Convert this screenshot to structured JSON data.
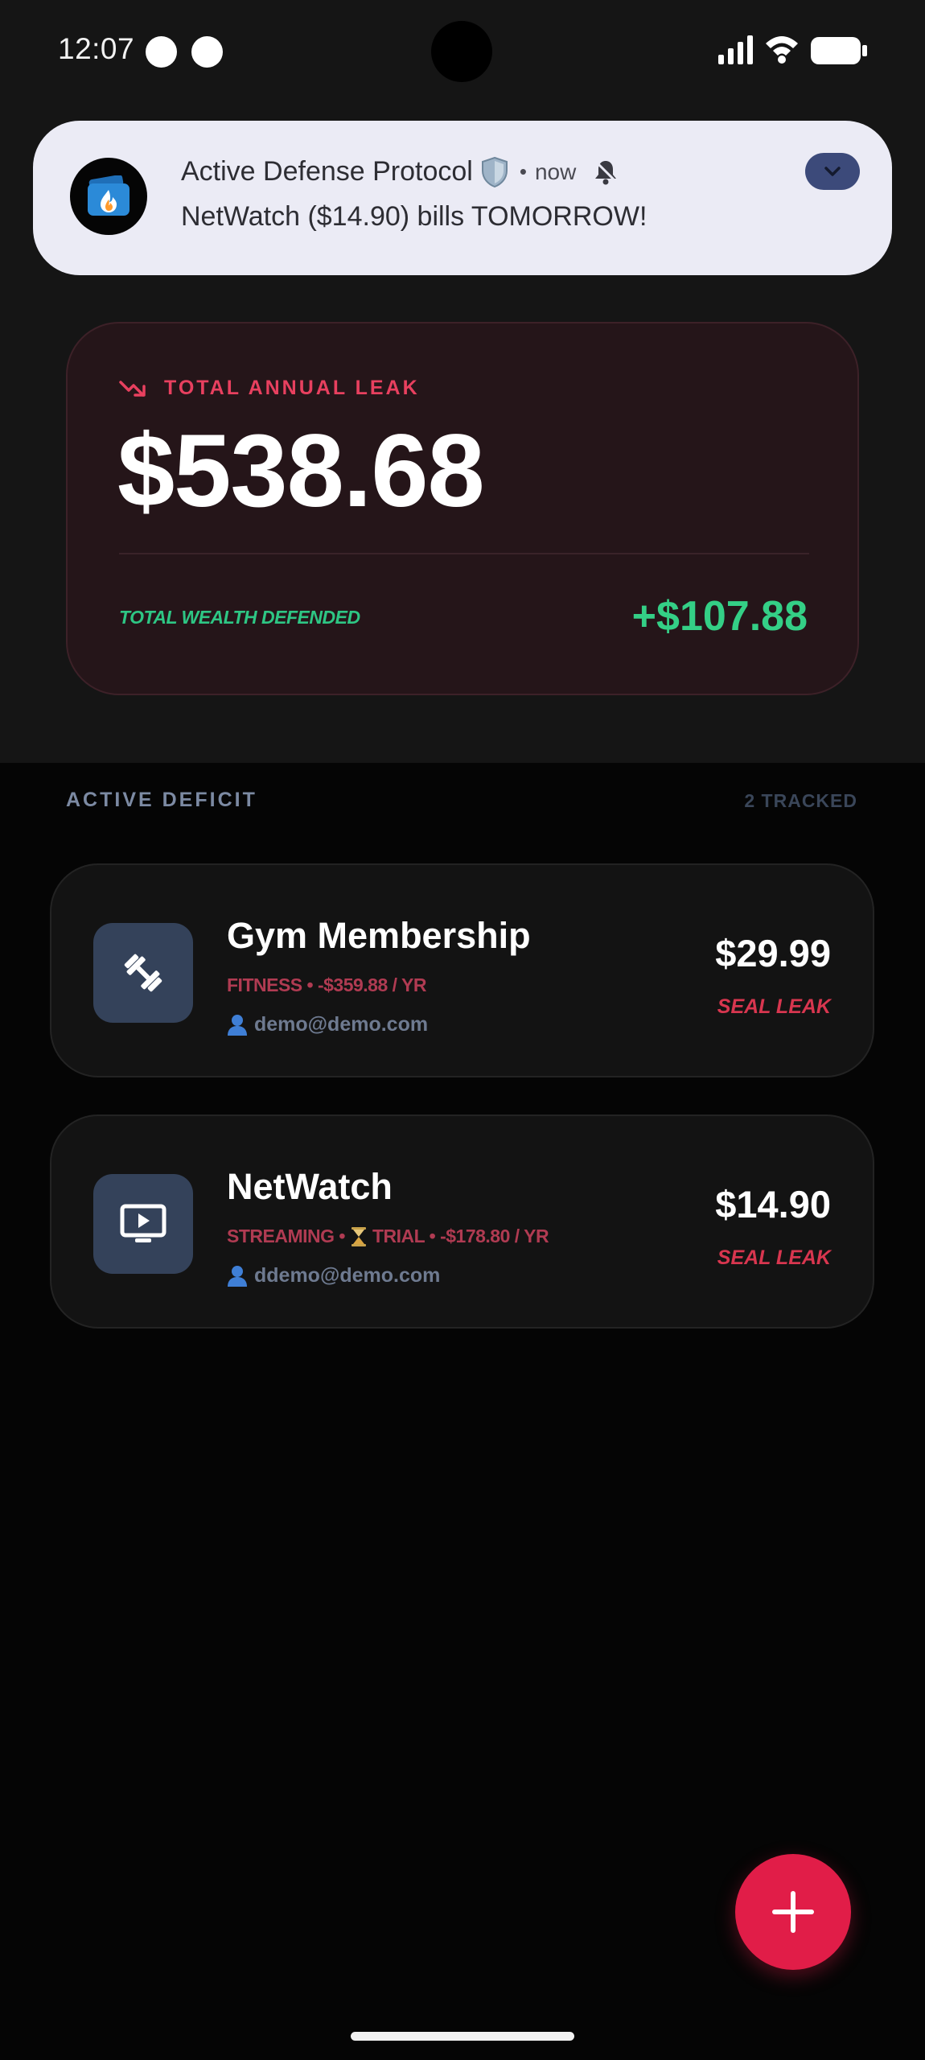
{
  "status_bar": {
    "time": "12:07"
  },
  "notification": {
    "title": "Active Defense Protocol",
    "time": "now",
    "body": "NetWatch ($14.90) bills TOMORROW!",
    "app_icon": "wallet-fire-icon"
  },
  "summary": {
    "leak_label": "TOTAL ANNUAL LEAK",
    "leak_amount": "$538.68",
    "defended_label": "TOTAL WEALTH DEFENDED",
    "defended_amount": "+$107.88"
  },
  "list": {
    "section_label": "ACTIVE DEFICIT",
    "count_label": "2 TRACKED",
    "items": [
      {
        "name": "Gym Membership",
        "meta": "FITNESS • -$359.88 / YR",
        "email": "demo@demo.com",
        "price": "$29.99",
        "action": "SEAL LEAK",
        "icon": "dumbbell-icon"
      },
      {
        "name": "NetWatch",
        "meta_category": "STREAMING •",
        "meta_rest": "TRIAL • -$178.80 / YR",
        "email": "ddemo@demo.com",
        "price": "$14.90",
        "action": "SEAL LEAK",
        "icon": "tv-play-icon"
      }
    ]
  },
  "fab": {
    "icon": "plus-icon"
  },
  "colors": {
    "accent": "#e11d48",
    "leak_red": "#e8405f",
    "defended_green": "#34cf86",
    "background": "#050505"
  }
}
